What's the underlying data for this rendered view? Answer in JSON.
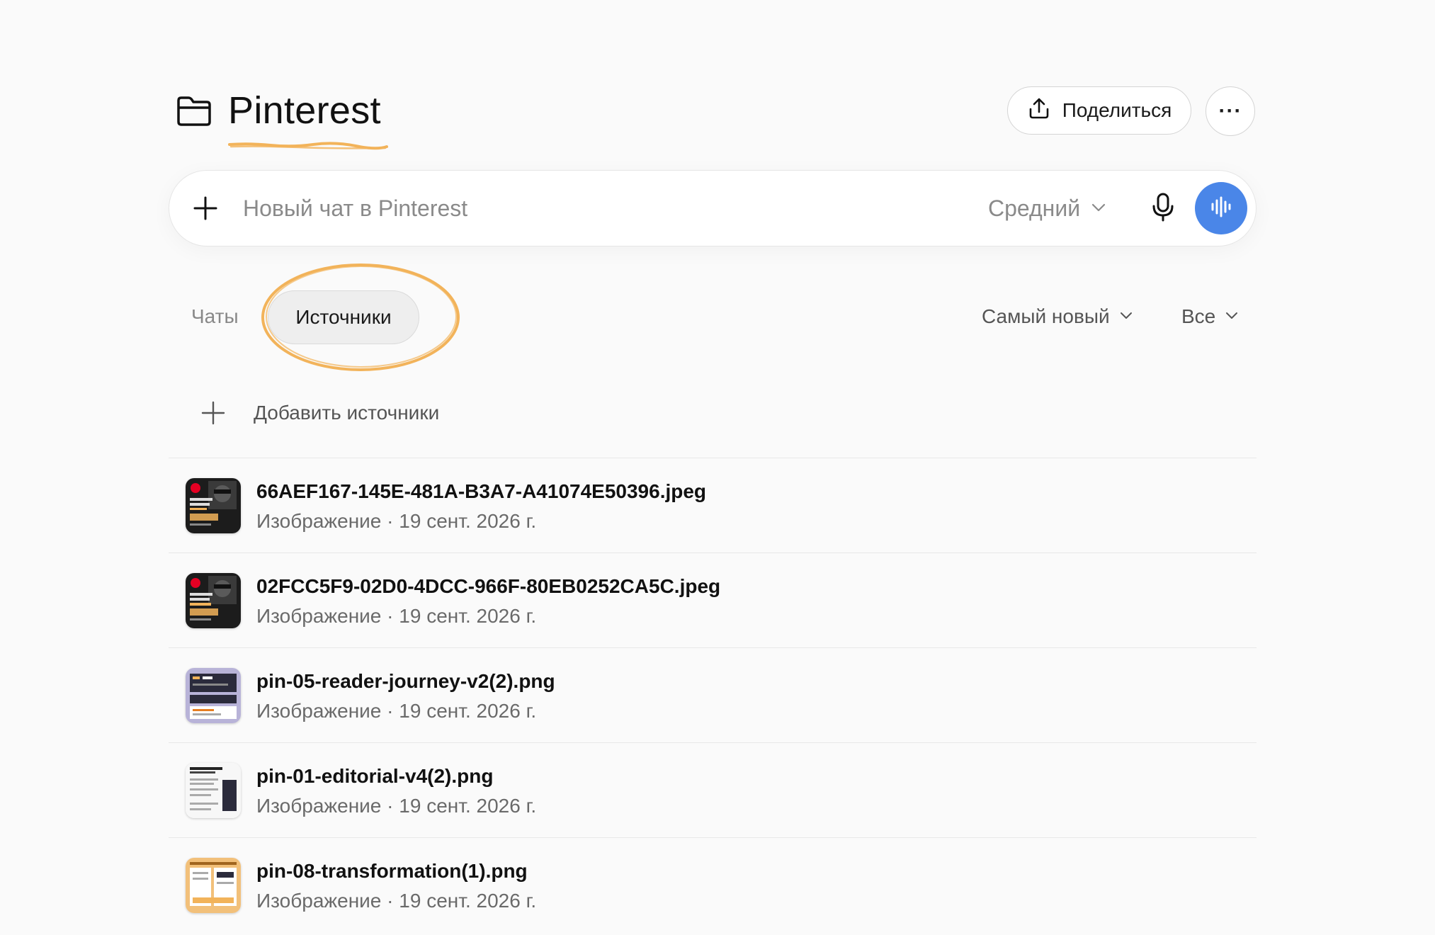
{
  "header": {
    "title": "Pinterest",
    "share_label": "Поделиться",
    "more_label": "···"
  },
  "chat": {
    "placeholder": "Новый чат в Pinterest",
    "model": "Средний"
  },
  "tabs": {
    "chats": "Чаты",
    "sources": "Источники"
  },
  "filters": {
    "sort": "Самый новый",
    "type": "Все"
  },
  "add_sources_label": "Добавить источники",
  "sources": [
    {
      "name": "66AEF167-145E-481A-B3A7-A41074E50396.jpeg",
      "meta": "Изображение · 19 сент. 2026 г.",
      "thumb": "dark-promo"
    },
    {
      "name": "02FCC5F9-02D0-4DCC-966F-80EB0252CA5C.jpeg",
      "meta": "Изображение · 19 сент. 2026 г.",
      "thumb": "dark-promo"
    },
    {
      "name": "pin-05-reader-journey-v2(2).png",
      "meta": "Изображение · 19 сент. 2026 г.",
      "thumb": "lavender-layout"
    },
    {
      "name": "pin-01-editorial-v4(2).png",
      "meta": "Изображение · 19 сент. 2026 г.",
      "thumb": "white-editorial"
    },
    {
      "name": "pin-08-transformation(1).png",
      "meta": "Изображение · 19 сент. 2026 г.",
      "thumb": "orange-layout"
    }
  ],
  "colors": {
    "accent_blue": "#4a86e8",
    "highlight_orange": "#f2b35a",
    "background": "#fafafa"
  },
  "icons": {
    "folder": "folder-icon",
    "share": "upload-icon",
    "more": "more-horizontal-icon",
    "plus": "plus-icon",
    "chevron": "chevron-down-icon",
    "mic": "microphone-icon",
    "voice": "voice-waveform-icon"
  }
}
